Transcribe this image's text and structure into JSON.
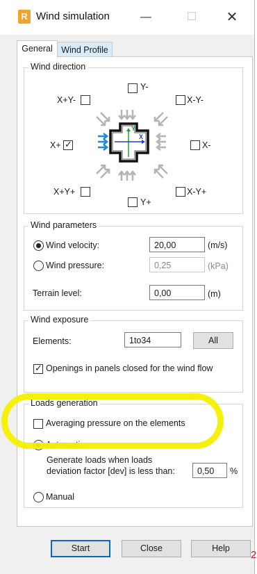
{
  "window": {
    "title": "Wind simulation",
    "app_icon_letter": "R"
  },
  "tabs": [
    {
      "label": "General",
      "active": true
    },
    {
      "label": "Wind Profile",
      "active": false
    }
  ],
  "wind_direction": {
    "group_label": "Wind direction",
    "directions": [
      {
        "label": "Y-",
        "checked": false
      },
      {
        "label": "X+Y-",
        "checked": false
      },
      {
        "label": "X-Y-",
        "checked": false
      },
      {
        "label": "X+",
        "checked": true
      },
      {
        "label": "X-",
        "checked": false
      },
      {
        "label": "X+Y+",
        "checked": false
      },
      {
        "label": "X-Y+",
        "checked": false
      },
      {
        "label": "Y+",
        "checked": false
      }
    ],
    "axis_labels": {
      "x": "X",
      "y": "Y"
    },
    "colors": {
      "active_arrow": "#1f8ad6",
      "inactive_arrow": "#b4b4b4",
      "y_axis": "#2a9a3a",
      "x_axis": "#1f3fc8"
    }
  },
  "wind_parameters": {
    "group_label": "Wind parameters",
    "velocity": {
      "label": "Wind velocity:",
      "value": "20,00",
      "unit": "(m/s)",
      "selected": true
    },
    "pressure": {
      "label": "Wind pressure:",
      "value": "0,25",
      "unit": "(kPa)",
      "selected": false
    },
    "terrain": {
      "label": "Terrain level:",
      "value": "0,00",
      "unit": "(m)"
    }
  },
  "wind_exposure": {
    "group_label": "Wind exposure",
    "elements_label": "Elements:",
    "elements_value": "1to34",
    "all_button": "All",
    "openings_label": "Openings in panels closed for the wind flow",
    "openings_checked": true
  },
  "loads_generation": {
    "group_label": "Loads generation",
    "averaging_label": "Averaging pressure on the elements",
    "averaging_checked": false,
    "automatic_label": "Automatic",
    "automatic_selected": true,
    "generate_line1": "Generate loads when loads",
    "generate_line2": "deviation factor [dev] is less than:",
    "factor_value": "0,50",
    "factor_unit": "%",
    "manual_label": "Manual",
    "manual_selected": false
  },
  "buttons": {
    "start": "Start",
    "close": "Close",
    "help": "Help"
  },
  "annotation": {
    "highlight_color": "#f4f000",
    "edge_mark": "2"
  }
}
